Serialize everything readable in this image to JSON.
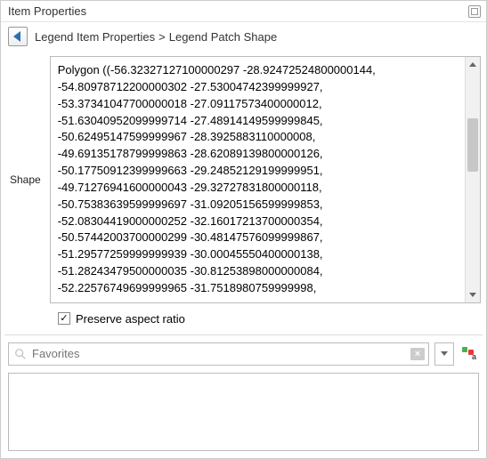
{
  "panel": {
    "title": "Item Properties",
    "breadcrumb": {
      "parent": "Legend Item Properties",
      "separator": ">",
      "current": "Legend Patch Shape"
    }
  },
  "shape": {
    "label": "Shape",
    "wkt": "Polygon ((-56.32327127100000297 -28.92472524800000144,\n-54.80978712200000302 -27.53004742399999927,\n-53.37341047700000018 -27.09117573400000012,\n-51.63040952099999714 -27.48914149599999845,\n-50.62495147599999967 -28.3925883110000008,\n-49.69135178799999863 -28.62089139800000126,\n-50.17750912399999663 -29.24852129199999951,\n-49.71276941600000043 -29.32727831800000118,\n-50.75383639599999697 -31.09205156599999853,\n-52.08304419000000252 -32.16017213700000354,\n-50.57442003700000299 -30.48147576099999867,\n-51.29577259999999939 -30.00045550400000138,\n-51.28243479500000035 -30.81253898000000084,\n-52.22576749699999965 -31.7518980759999998,"
  },
  "preserve": {
    "checked": true,
    "label": "Preserve aspect ratio",
    "glyph": "✓"
  },
  "search": {
    "placeholder": "Favorites"
  }
}
